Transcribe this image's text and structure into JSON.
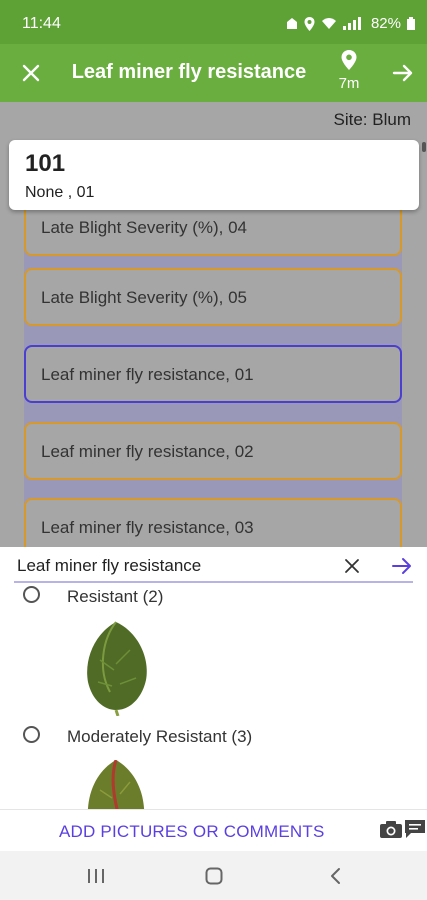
{
  "status": {
    "time": "11:44",
    "battery": "82%"
  },
  "app_bar": {
    "title": "Leaf miner fly resistance",
    "location_distance": "7m",
    "close_icon": "close-icon",
    "next_icon": "arrow-right-icon"
  },
  "site": {
    "label": "Site: Blum"
  },
  "plot": {
    "number": "101",
    "subtitle": "None , 01"
  },
  "traits": [
    "Late Blight Severity (%), 04",
    "Late Blight Severity (%), 05",
    "Leaf miner fly resistance, 01",
    "Leaf miner fly resistance, 02",
    "Leaf miner fly resistance, 03"
  ],
  "sheet": {
    "title": "Leaf miner fly resistance",
    "options": [
      "Resistant (2)",
      "Moderately Resistant (3)"
    ]
  },
  "footer": {
    "button": "ADD PICTURES OR COMMENTS"
  },
  "colors": {
    "status_bar": "#5ea236",
    "app_bar": "#6aae3f",
    "accent": "#5b3fe0",
    "item_border": "#d79a2a",
    "selected_border": "#4a3fd0"
  }
}
